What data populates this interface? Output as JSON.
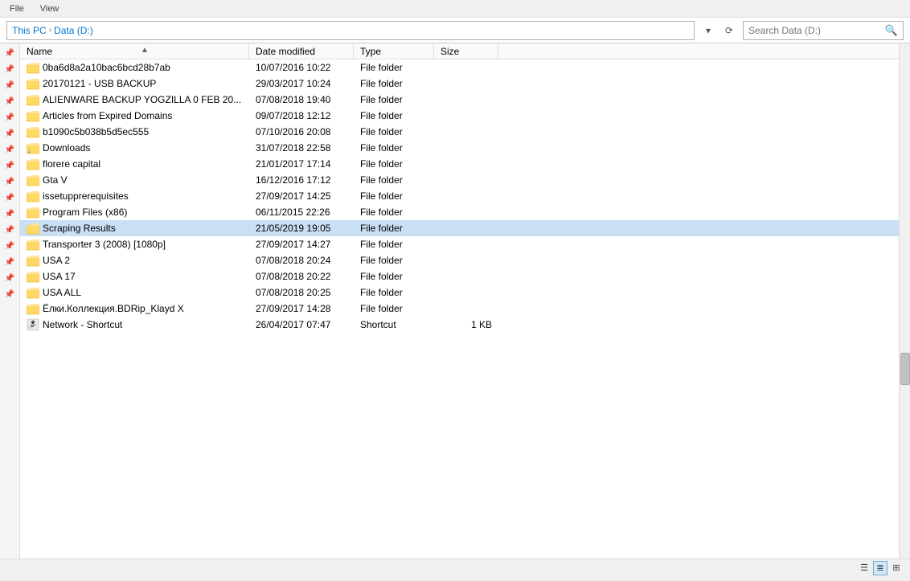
{
  "window": {
    "menu": [
      "File",
      "View"
    ],
    "title": "Data (D:)"
  },
  "addressbar": {
    "this_pc": "This PC",
    "separator": "›",
    "drive": "Data (D:)",
    "refresh_btn": "⟳",
    "dropdown_btn": "▾",
    "search_placeholder": "Search Data (D:)"
  },
  "columns": {
    "name": "Name",
    "date_modified": "Date modified",
    "type": "Type",
    "size": "Size"
  },
  "files": [
    {
      "name": "0ba6d8a2a10bac6bcd28b7ab",
      "date": "10/07/2016 10:22",
      "type": "File folder",
      "size": "",
      "icon": "folder",
      "selected": false
    },
    {
      "name": "20170121 - USB BACKUP",
      "date": "29/03/2017 10:24",
      "type": "File folder",
      "size": "",
      "icon": "folder",
      "selected": false
    },
    {
      "name": "ALIENWARE BACKUP YOGZILLA 0 FEB 20...",
      "date": "07/08/2018 19:40",
      "type": "File folder",
      "size": "",
      "icon": "folder",
      "selected": false
    },
    {
      "name": "Articles from Expired Domains",
      "date": "09/07/2018 12:12",
      "type": "File folder",
      "size": "",
      "icon": "folder",
      "selected": false
    },
    {
      "name": "b1090c5b038b5d5ec555",
      "date": "07/10/2016 20:08",
      "type": "File folder",
      "size": "",
      "icon": "folder",
      "selected": false
    },
    {
      "name": "Downloads",
      "date": "31/07/2018 22:58",
      "type": "File folder",
      "size": "",
      "icon": "folder-download",
      "selected": false
    },
    {
      "name": "florere capital",
      "date": "21/01/2017 17:14",
      "type": "File folder",
      "size": "",
      "icon": "folder",
      "selected": false
    },
    {
      "name": "Gta V",
      "date": "16/12/2016 17:12",
      "type": "File folder",
      "size": "",
      "icon": "folder",
      "selected": false
    },
    {
      "name": "issetupprerequisites",
      "date": "27/09/2017 14:25",
      "type": "File folder",
      "size": "",
      "icon": "folder",
      "selected": false
    },
    {
      "name": "Program Files (x86)",
      "date": "06/11/2015 22:26",
      "type": "File folder",
      "size": "",
      "icon": "folder",
      "selected": false
    },
    {
      "name": "Scraping Results",
      "date": "21/05/2019 19:05",
      "type": "File folder",
      "size": "",
      "icon": "folder",
      "selected": true
    },
    {
      "name": "Transporter 3 (2008) [1080p]",
      "date": "27/09/2017 14:27",
      "type": "File folder",
      "size": "",
      "icon": "folder",
      "selected": false
    },
    {
      "name": "USA 2",
      "date": "07/08/2018 20:24",
      "type": "File folder",
      "size": "",
      "icon": "folder",
      "selected": false
    },
    {
      "name": "USA 17",
      "date": "07/08/2018 20:22",
      "type": "File folder",
      "size": "",
      "icon": "folder",
      "selected": false
    },
    {
      "name": "USA ALL",
      "date": "07/08/2018 20:25",
      "type": "File folder",
      "size": "",
      "icon": "folder",
      "selected": false
    },
    {
      "name": "Ёлки.Коллекция.BDRip_Klayd X",
      "date": "27/09/2017 14:28",
      "type": "File folder",
      "size": "",
      "icon": "folder",
      "selected": false
    },
    {
      "name": "Network - Shortcut",
      "date": "26/04/2017 07:47",
      "type": "Shortcut",
      "size": "1 KB",
      "icon": "shortcut",
      "selected": false
    }
  ],
  "status": {
    "left": "",
    "view_list": "☰",
    "view_details": "≣",
    "view_tiles": "⊞"
  }
}
